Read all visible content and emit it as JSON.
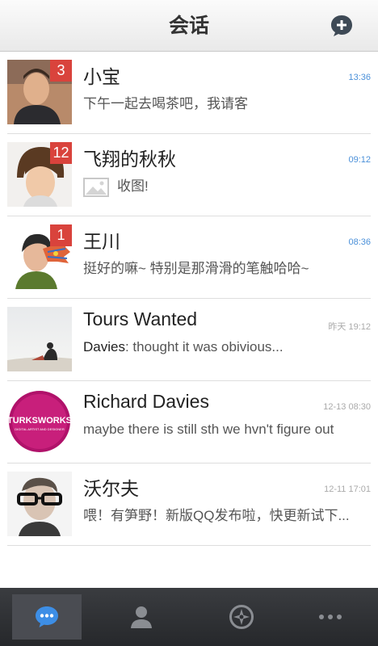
{
  "header": {
    "title": "会话"
  },
  "colors": {
    "badge": "#d9433c",
    "time_blue": "#4a90d9",
    "active_tab_icon": "#3d8ee6"
  },
  "conversations": [
    {
      "name": "小宝",
      "badge": "3",
      "time": "13:36",
      "preview": "下午一起去喝茶吧，我请客"
    },
    {
      "name": "飞翔的秋秋",
      "badge": "12",
      "time": "09:12",
      "preview": "收图!"
    },
    {
      "name": "王川",
      "badge": "1",
      "time": "08:36",
      "preview": "挺好的嘛~ 特别是那滑滑的笔触哈哈~"
    },
    {
      "name": "Tours Wanted",
      "time": "昨天 19:12",
      "sender": "Davies",
      "preview": ": thought it was obivious..."
    },
    {
      "name": "Richard Davies",
      "time": "12-13 08:30",
      "preview": "maybe there is still sth we hvn't figure out",
      "avatar_text": "TURKSWORKS",
      "avatar_subtext": "DIGITAL ARTIST AND DESIGNER"
    },
    {
      "name": "沃尔夫",
      "time": "12-11 17:01",
      "preview": "喂！有笋野！新版QQ发布啦，快更新试下..."
    }
  ],
  "tabs": [
    {
      "icon": "chat-bubble-icon",
      "active": true
    },
    {
      "icon": "contacts-icon"
    },
    {
      "icon": "compass-icon"
    },
    {
      "icon": "more-dots-icon"
    }
  ]
}
